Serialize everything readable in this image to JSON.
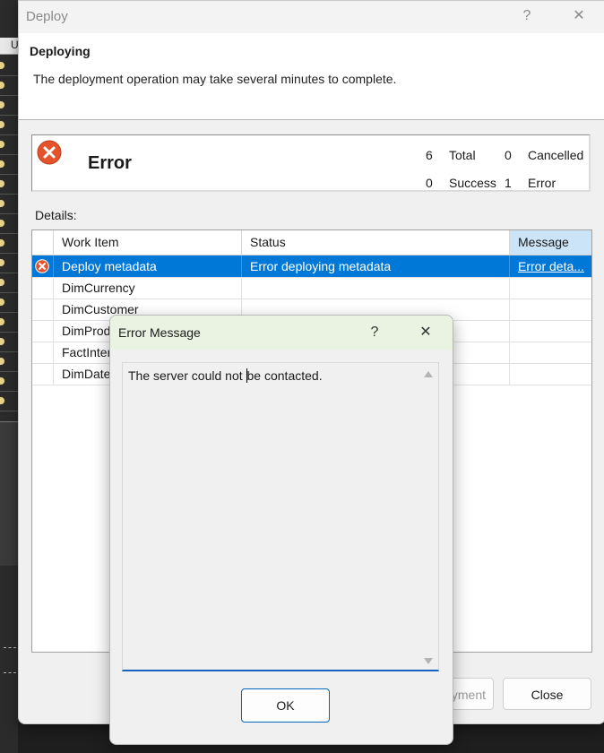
{
  "background": {
    "column_letter": "U"
  },
  "deploy_dialog": {
    "title": "Deploy",
    "help_glyph": "?",
    "close_glyph": "✕",
    "heading": "Deploying",
    "description": "The deployment operation may take several minutes to complete.",
    "status": {
      "icon": "error-circle-icon",
      "text": "Error",
      "counts": {
        "total_value": "6",
        "total_label": "Total",
        "cancelled_value": "0",
        "cancelled_label": "Cancelled",
        "success_value": "0",
        "success_label": "Success",
        "error_value": "1",
        "error_label": "Error"
      }
    },
    "details_label": "Details:",
    "grid": {
      "columns": [
        "Work Item",
        "Status",
        "Message"
      ],
      "rows": [
        {
          "work_item": "Deploy metadata",
          "status": "Error deploying metadata",
          "message": "Error deta...",
          "selected": true,
          "icon": "error-circle-icon"
        },
        {
          "work_item": "DimCurrency",
          "status": "",
          "message": ""
        },
        {
          "work_item": "DimCustomer",
          "status": "",
          "message": ""
        },
        {
          "work_item": "DimProd",
          "status": "",
          "message": ""
        },
        {
          "work_item": "FactInter",
          "status": "",
          "message": ""
        },
        {
          "work_item": "DimDate",
          "status": "",
          "message": ""
        }
      ]
    },
    "buttons": {
      "deploy_partial": "yment",
      "close": "Close"
    }
  },
  "error_dialog": {
    "title": "Error Message",
    "help_glyph": "?",
    "close_glyph": "✕",
    "message_before_caret": "The server could not ",
    "message_after_caret": "be contacted.",
    "ok_label": "OK"
  },
  "colors": {
    "selection": "#0078d7",
    "error_icon": "#e5532d",
    "error_dialog_title": "#eaf2e1",
    "message_header": "#cce4f7",
    "focus_underline": "#1565c0"
  }
}
